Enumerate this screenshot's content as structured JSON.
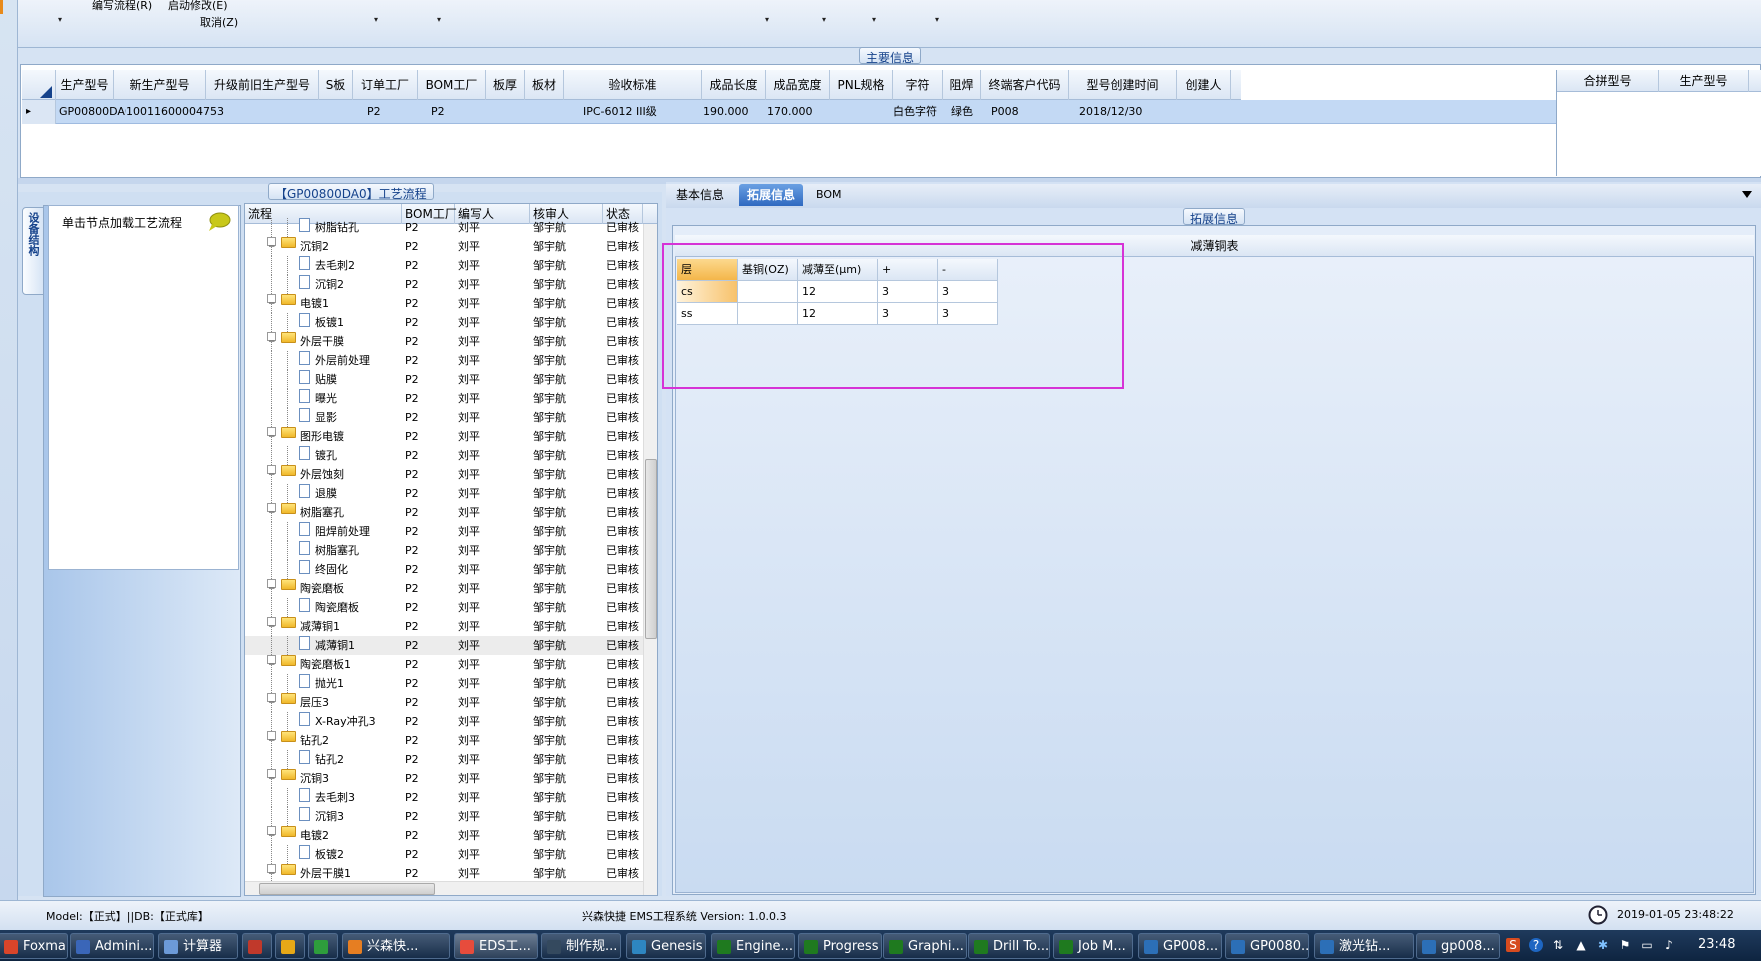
{
  "toolbar": {
    "menu_edit_flow": "编写流程(R)",
    "menu_start_modify": "启动修改(E)",
    "menu_cancel": "取消(Z)",
    "dropdown_glyph": "▾"
  },
  "main_info": {
    "section_title": "主要信息",
    "columns": [
      "生产型号",
      "新生产型号",
      "升级前旧生产型号",
      "S板",
      "订单工厂",
      "BOM工厂",
      "板厚",
      "板材",
      "验收标准",
      "成品长度",
      "成品宽度",
      "PNL规格",
      "字符",
      "阻焊",
      "终端客户代码",
      "型号创建时间",
      "创建人"
    ],
    "row": {
      "marker": "▸",
      "生产型号": "GP00800DA0",
      "新生产型号": "10011600004753",
      "订单工厂": "P2",
      "BOM工厂": "P2",
      "验收标准": "IPC-6012 III级",
      "成品长度": "190.000",
      "成品宽度": "170.000",
      "字符": "白色字符",
      "阻焊": "绿色",
      "终端客户代码": "P008",
      "型号创建时间": "2018/12/30"
    },
    "merge_columns": [
      "合拼型号",
      "生产型号"
    ]
  },
  "side_tab": {
    "label": "设备结构"
  },
  "hint": {
    "text": "单击节点加载工艺流程"
  },
  "flow": {
    "title": "【GP00800DA0】工艺流程",
    "columns": [
      "流程",
      "BOM工厂",
      "编写人",
      "核审人",
      "状态"
    ],
    "rows": [
      {
        "level": 2,
        "type": "doc",
        "name": "树脂钻孔",
        "bom": "P2",
        "author": "刘平",
        "reviewer": "邹宇航",
        "status": "已审核",
        "sel": false
      },
      {
        "level": 1,
        "type": "folder",
        "name": "沉铜2",
        "bom": "P2",
        "author": "刘平",
        "reviewer": "邹宇航",
        "status": "已审核",
        "sel": false
      },
      {
        "level": 2,
        "type": "doc",
        "name": "去毛刺2",
        "bom": "P2",
        "author": "刘平",
        "reviewer": "邹宇航",
        "status": "已审核",
        "sel": false
      },
      {
        "level": 2,
        "type": "doc",
        "name": "沉铜2",
        "bom": "P2",
        "author": "刘平",
        "reviewer": "邹宇航",
        "status": "已审核",
        "sel": false
      },
      {
        "level": 1,
        "type": "folder",
        "name": "电镀1",
        "bom": "P2",
        "author": "刘平",
        "reviewer": "邹宇航",
        "status": "已审核",
        "sel": false
      },
      {
        "level": 2,
        "type": "doc",
        "name": "板镀1",
        "bom": "P2",
        "author": "刘平",
        "reviewer": "邹宇航",
        "status": "已审核",
        "sel": false
      },
      {
        "level": 1,
        "type": "folder",
        "name": "外层干膜",
        "bom": "P2",
        "author": "刘平",
        "reviewer": "邹宇航",
        "status": "已审核",
        "sel": false
      },
      {
        "level": 2,
        "type": "doc",
        "name": "外层前处理",
        "bom": "P2",
        "author": "刘平",
        "reviewer": "邹宇航",
        "status": "已审核",
        "sel": false
      },
      {
        "level": 2,
        "type": "doc",
        "name": "贴膜",
        "bom": "P2",
        "author": "刘平",
        "reviewer": "邹宇航",
        "status": "已审核",
        "sel": false
      },
      {
        "level": 2,
        "type": "doc",
        "name": "曝光",
        "bom": "P2",
        "author": "刘平",
        "reviewer": "邹宇航",
        "status": "已审核",
        "sel": false
      },
      {
        "level": 2,
        "type": "doc",
        "name": "显影",
        "bom": "P2",
        "author": "刘平",
        "reviewer": "邹宇航",
        "status": "已审核",
        "sel": false
      },
      {
        "level": 1,
        "type": "folder",
        "name": "图形电镀",
        "bom": "P2",
        "author": "刘平",
        "reviewer": "邹宇航",
        "status": "已审核",
        "sel": false
      },
      {
        "level": 2,
        "type": "doc",
        "name": "镀孔",
        "bom": "P2",
        "author": "刘平",
        "reviewer": "邹宇航",
        "status": "已审核",
        "sel": false
      },
      {
        "level": 1,
        "type": "folder",
        "name": "外层蚀刻",
        "bom": "P2",
        "author": "刘平",
        "reviewer": "邹宇航",
        "status": "已审核",
        "sel": false
      },
      {
        "level": 2,
        "type": "doc",
        "name": "退膜",
        "bom": "P2",
        "author": "刘平",
        "reviewer": "邹宇航",
        "status": "已审核",
        "sel": false
      },
      {
        "level": 1,
        "type": "folder",
        "name": "树脂塞孔",
        "bom": "P2",
        "author": "刘平",
        "reviewer": "邹宇航",
        "status": "已审核",
        "sel": false
      },
      {
        "level": 2,
        "type": "doc",
        "name": "阻焊前处理",
        "bom": "P2",
        "author": "刘平",
        "reviewer": "邹宇航",
        "status": "已审核",
        "sel": false
      },
      {
        "level": 2,
        "type": "doc",
        "name": "树脂塞孔",
        "bom": "P2",
        "author": "刘平",
        "reviewer": "邹宇航",
        "status": "已审核",
        "sel": false
      },
      {
        "level": 2,
        "type": "doc",
        "name": "终固化",
        "bom": "P2",
        "author": "刘平",
        "reviewer": "邹宇航",
        "status": "已审核",
        "sel": false
      },
      {
        "level": 1,
        "type": "folder",
        "name": "陶瓷磨板",
        "bom": "P2",
        "author": "刘平",
        "reviewer": "邹宇航",
        "status": "已审核",
        "sel": false
      },
      {
        "level": 2,
        "type": "doc",
        "name": "陶瓷磨板",
        "bom": "P2",
        "author": "刘平",
        "reviewer": "邹宇航",
        "status": "已审核",
        "sel": false
      },
      {
        "level": 1,
        "type": "folder",
        "name": "减薄铜1",
        "bom": "P2",
        "author": "刘平",
        "reviewer": "邹宇航",
        "status": "已审核",
        "sel": false
      },
      {
        "level": 2,
        "type": "doc",
        "name": "减薄铜1",
        "bom": "P2",
        "author": "刘平",
        "reviewer": "邹宇航",
        "status": "已审核",
        "sel": true
      },
      {
        "level": 1,
        "type": "folder",
        "name": "陶瓷磨板1",
        "bom": "P2",
        "author": "刘平",
        "reviewer": "邹宇航",
        "status": "已审核",
        "sel": false
      },
      {
        "level": 2,
        "type": "doc",
        "name": "抛光1",
        "bom": "P2",
        "author": "刘平",
        "reviewer": "邹宇航",
        "status": "已审核",
        "sel": false
      },
      {
        "level": 1,
        "type": "folder",
        "name": "层压3",
        "bom": "P2",
        "author": "刘平",
        "reviewer": "邹宇航",
        "status": "已审核",
        "sel": false
      },
      {
        "level": 2,
        "type": "doc",
        "name": "X-Ray冲孔3",
        "bom": "P2",
        "author": "刘平",
        "reviewer": "邹宇航",
        "status": "已审核",
        "sel": false
      },
      {
        "level": 1,
        "type": "folder",
        "name": "钻孔2",
        "bom": "P2",
        "author": "刘平",
        "reviewer": "邹宇航",
        "status": "已审核",
        "sel": false
      },
      {
        "level": 2,
        "type": "doc",
        "name": "钻孔2",
        "bom": "P2",
        "author": "刘平",
        "reviewer": "邹宇航",
        "status": "已审核",
        "sel": false
      },
      {
        "level": 1,
        "type": "folder",
        "name": "沉铜3",
        "bom": "P2",
        "author": "刘平",
        "reviewer": "邹宇航",
        "status": "已审核",
        "sel": false
      },
      {
        "level": 2,
        "type": "doc",
        "name": "去毛刺3",
        "bom": "P2",
        "author": "刘平",
        "reviewer": "邹宇航",
        "status": "已审核",
        "sel": false
      },
      {
        "level": 2,
        "type": "doc",
        "name": "沉铜3",
        "bom": "P2",
        "author": "刘平",
        "reviewer": "邹宇航",
        "status": "已审核",
        "sel": false
      },
      {
        "level": 1,
        "type": "folder",
        "name": "电镀2",
        "bom": "P2",
        "author": "刘平",
        "reviewer": "邹宇航",
        "status": "已审核",
        "sel": false
      },
      {
        "level": 2,
        "type": "doc",
        "name": "板镀2",
        "bom": "P2",
        "author": "刘平",
        "reviewer": "邹宇航",
        "status": "已审核",
        "sel": false
      },
      {
        "level": 1,
        "type": "folder",
        "name": "外层干膜1",
        "bom": "P2",
        "author": "刘平",
        "reviewer": "邹宇航",
        "status": "已审核",
        "sel": false
      }
    ]
  },
  "tabs": {
    "basic": "基本信息",
    "ext": "拓展信息",
    "bom": "BOM"
  },
  "ext": {
    "section_title": "拓展信息",
    "table_title": "减薄铜表",
    "columns": [
      "层",
      "基铜(OZ)",
      "减薄至(μm)",
      "+",
      "-"
    ],
    "rows": [
      [
        "cs",
        "",
        "12",
        "3",
        "3"
      ],
      [
        "ss",
        "",
        "12",
        "3",
        "3"
      ]
    ]
  },
  "status_bar": {
    "left": "Model:【正式】||DB:【正式库】",
    "center": "兴森快捷 EMS工程系统 Version: 1.0.0.3",
    "datetime": "2019-01-05 23:48:22"
  },
  "taskbar": {
    "items": [
      "Foxmail",
      "Admini...",
      "计算器",
      "",
      "",
      "",
      "兴森快...",
      "EDS工...",
      "制作规...",
      "Genesis",
      "Engine...",
      "Progress",
      "Graphi...",
      "Drill To...",
      "Job M...",
      "GP008...",
      "GP0080...",
      "激光钻...",
      "gp008..."
    ],
    "clock": "23:48"
  },
  "colors": {
    "accent": "#2f69c0",
    "highlight": "#d633d6",
    "selection": "#c3d9f4"
  }
}
